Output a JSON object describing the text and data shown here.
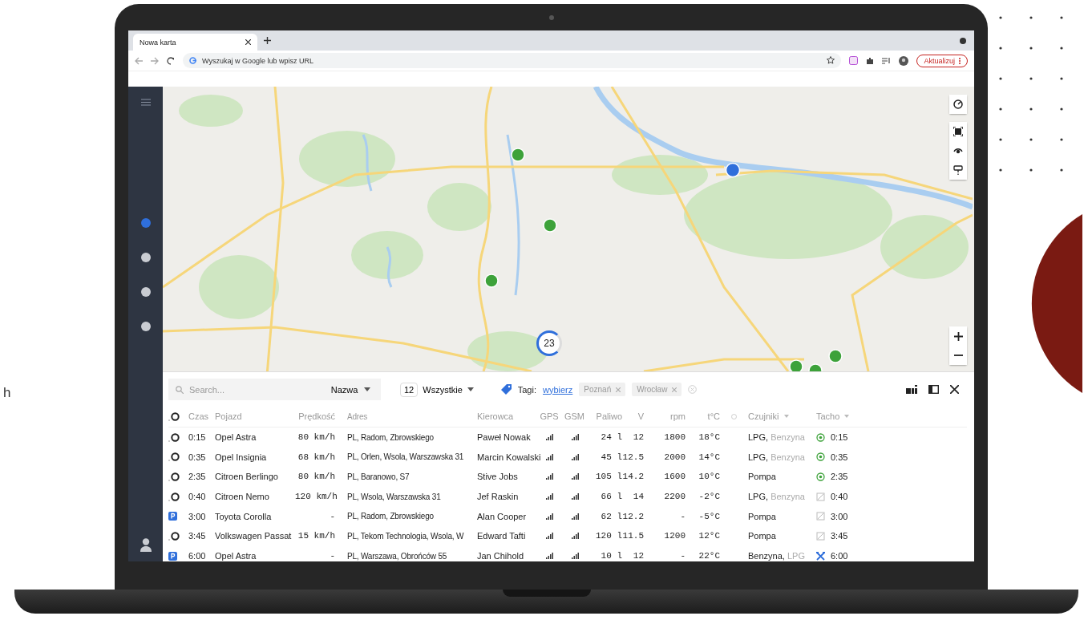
{
  "side_text": "h",
  "browser": {
    "tab_title": "Nowa karta",
    "address_placeholder": "Wyszukaj w Google lub wpisz URL",
    "update_button": "Aktualizuj"
  },
  "sidebar": {
    "items": [
      {
        "selected": true
      },
      {
        "selected": false
      },
      {
        "selected": false
      },
      {
        "selected": false
      }
    ]
  },
  "map": {
    "cluster_count": "23"
  },
  "panel": {
    "search": {
      "placeholder": "Search...",
      "sort": "Nazwa"
    },
    "filter": {
      "count": "12",
      "label": "Wszystkie"
    },
    "tags": {
      "label": "Tagi:",
      "link": "wybierz",
      "chips": [
        "Poznań",
        "Wrocław"
      ]
    },
    "columns": [
      "Czas",
      "Pojazd",
      "Prędkość",
      "Adres",
      "Kierowca",
      "GPS",
      "GSM",
      "Paliwo",
      "V",
      "rpm",
      "t°C",
      "Czujniki",
      "Tacho"
    ],
    "rows": [
      {
        "kind": "moving",
        "time": "0:15",
        "vehicle": "Opel Astra",
        "speed": "80 km/h",
        "address": "PL, Radom, Zbrowskiego",
        "driver": "Paweł Nowak",
        "fuel": "24 l",
        "voltage": "12",
        "rpm": "1800",
        "temp": "18°C",
        "sensors": "LPG,",
        "sensors_extra": "Benzyna",
        "tacho": {
          "kind": "active",
          "time": "0:15"
        }
      },
      {
        "kind": "moving",
        "time": "0:35",
        "vehicle": "Opel Insignia",
        "speed": "68 km/h",
        "address": "PL, Orlen, Wsola, Warszawska 31",
        "driver": "Marcin Kowalski",
        "fuel": "45 l",
        "voltage": "12.5",
        "rpm": "2000",
        "temp": "14°C",
        "sensors": "LPG,",
        "sensors_extra": "Benzyna",
        "tacho": {
          "kind": "active",
          "time": "0:35"
        }
      },
      {
        "kind": "moving",
        "time": "2:35",
        "vehicle": "Citroen Berlingo",
        "speed": "80 km/h",
        "address": "PL, Baranowo, S7",
        "driver": "Stive Jobs",
        "fuel": "105 l",
        "voltage": "14.2",
        "rpm": "1600",
        "temp": "10°C",
        "sensors": "Pompa",
        "tacho": {
          "kind": "active",
          "time": "2:35"
        }
      },
      {
        "kind": "moving",
        "time": "0:40",
        "vehicle": "Citroen Nemo",
        "speed": "120 km/h",
        "address": "PL, Wsola, Warszawska 31",
        "driver": "Jef Raskin",
        "fuel": "66 l",
        "voltage": "14",
        "rpm": "2200",
        "temp": "-2°C",
        "sensors": "LPG,",
        "sensors_extra": "Benzyna",
        "tacho": {
          "kind": "rest",
          "time": "0:40"
        }
      },
      {
        "kind": "parked",
        "time": "3:00",
        "vehicle": "Toyota Corolla",
        "speed": "-",
        "address": "PL, Radom, Zbrowskiego",
        "driver": "Alan Cooper",
        "fuel": "62 l",
        "voltage": "12.2",
        "rpm": "-",
        "temp": "-5°C",
        "sensors": "Pompa",
        "tacho": {
          "kind": "rest",
          "time": "3:00"
        }
      },
      {
        "kind": "moving",
        "time": "3:45",
        "vehicle": "Volkswagen Passat",
        "speed": "15 km/h",
        "address": "PL, Tekom Technologia, Wsola, W",
        "driver": "Edward Tafti",
        "fuel": "120 l",
        "voltage": "11.5",
        "rpm": "1200",
        "temp": "12°C",
        "sensors": "Pompa",
        "tacho": {
          "kind": "rest",
          "time": "3:45"
        }
      },
      {
        "kind": "parked",
        "time": "6:00",
        "vehicle": "Opel Astra",
        "speed": "-",
        "address": "PL, Warszawa, Obrońców 55",
        "driver": "Jan Chihold",
        "fuel": "10 l",
        "voltage": "12",
        "rpm": "-",
        "temp": "22°C",
        "sensors": "Benzyna,",
        "sensors_extra": "LPG",
        "tacho": {
          "kind": "work",
          "time": "6:00"
        }
      }
    ]
  }
}
